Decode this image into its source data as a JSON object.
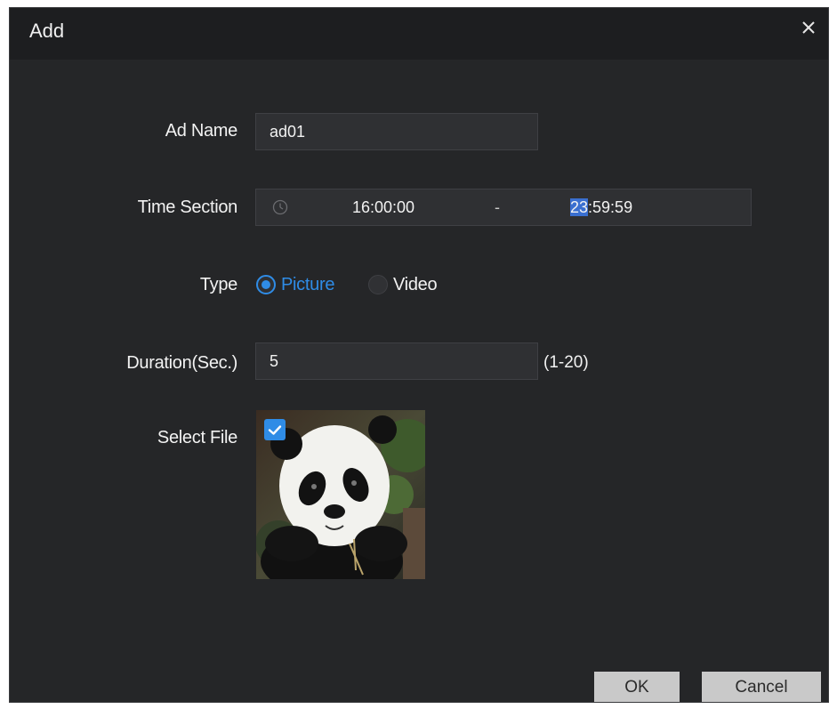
{
  "dialog": {
    "title": "Add",
    "close_glyph": "×"
  },
  "form": {
    "ad_name": {
      "label": "Ad Name",
      "value": "ad01"
    },
    "time_section": {
      "label": "Time Section",
      "icon": "clock-icon",
      "start": "16:00:00",
      "separator": "-",
      "end_selected": "23",
      "end_rest": ":59:59"
    },
    "type": {
      "label": "Type",
      "options": [
        {
          "label": "Picture",
          "selected": true
        },
        {
          "label": "Video",
          "selected": false
        }
      ]
    },
    "duration": {
      "label": "Duration(Sec.)",
      "value": "5",
      "range_hint": "(1-20)"
    },
    "select_file": {
      "label": "Select File",
      "checked": true
    }
  },
  "buttons": {
    "ok": "OK",
    "cancel": "Cancel"
  },
  "colors": {
    "accent": "#2f8ce6",
    "dialog_bg": "#252628",
    "title_bg": "#1d1e20",
    "input_bg": "#2f3033",
    "button_bg": "#c9c9c9"
  }
}
